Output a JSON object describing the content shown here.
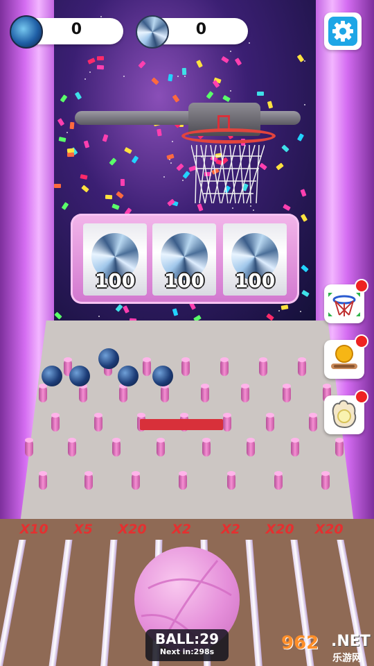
{
  "hud": {
    "score_left": "0",
    "score_right": "0",
    "settings_icon": "gear-icon"
  },
  "slot": {
    "reels": [
      {
        "value": "100",
        "icon": "diamond-ball-icon"
      },
      {
        "value": "100",
        "icon": "diamond-ball-icon"
      },
      {
        "value": "100",
        "icon": "diamond-ball-icon"
      }
    ]
  },
  "multipliers": [
    "X10",
    "X5",
    "X20",
    "X2",
    "X2",
    "X20",
    "X20"
  ],
  "counter": {
    "balls": "BALL:29",
    "next": "Next in:298s"
  },
  "powerups": [
    {
      "icon": "expand-hoop-icon"
    },
    {
      "icon": "golden-ball-icon"
    },
    {
      "icon": "glove-ball-icon"
    }
  ],
  "watermark": {
    "brand": "962",
    "tld": ".NET",
    "sub": "乐游网"
  },
  "colors": {
    "multiplier": "#e43030",
    "settings": "#1ea6e6",
    "notification": "#e22222"
  }
}
